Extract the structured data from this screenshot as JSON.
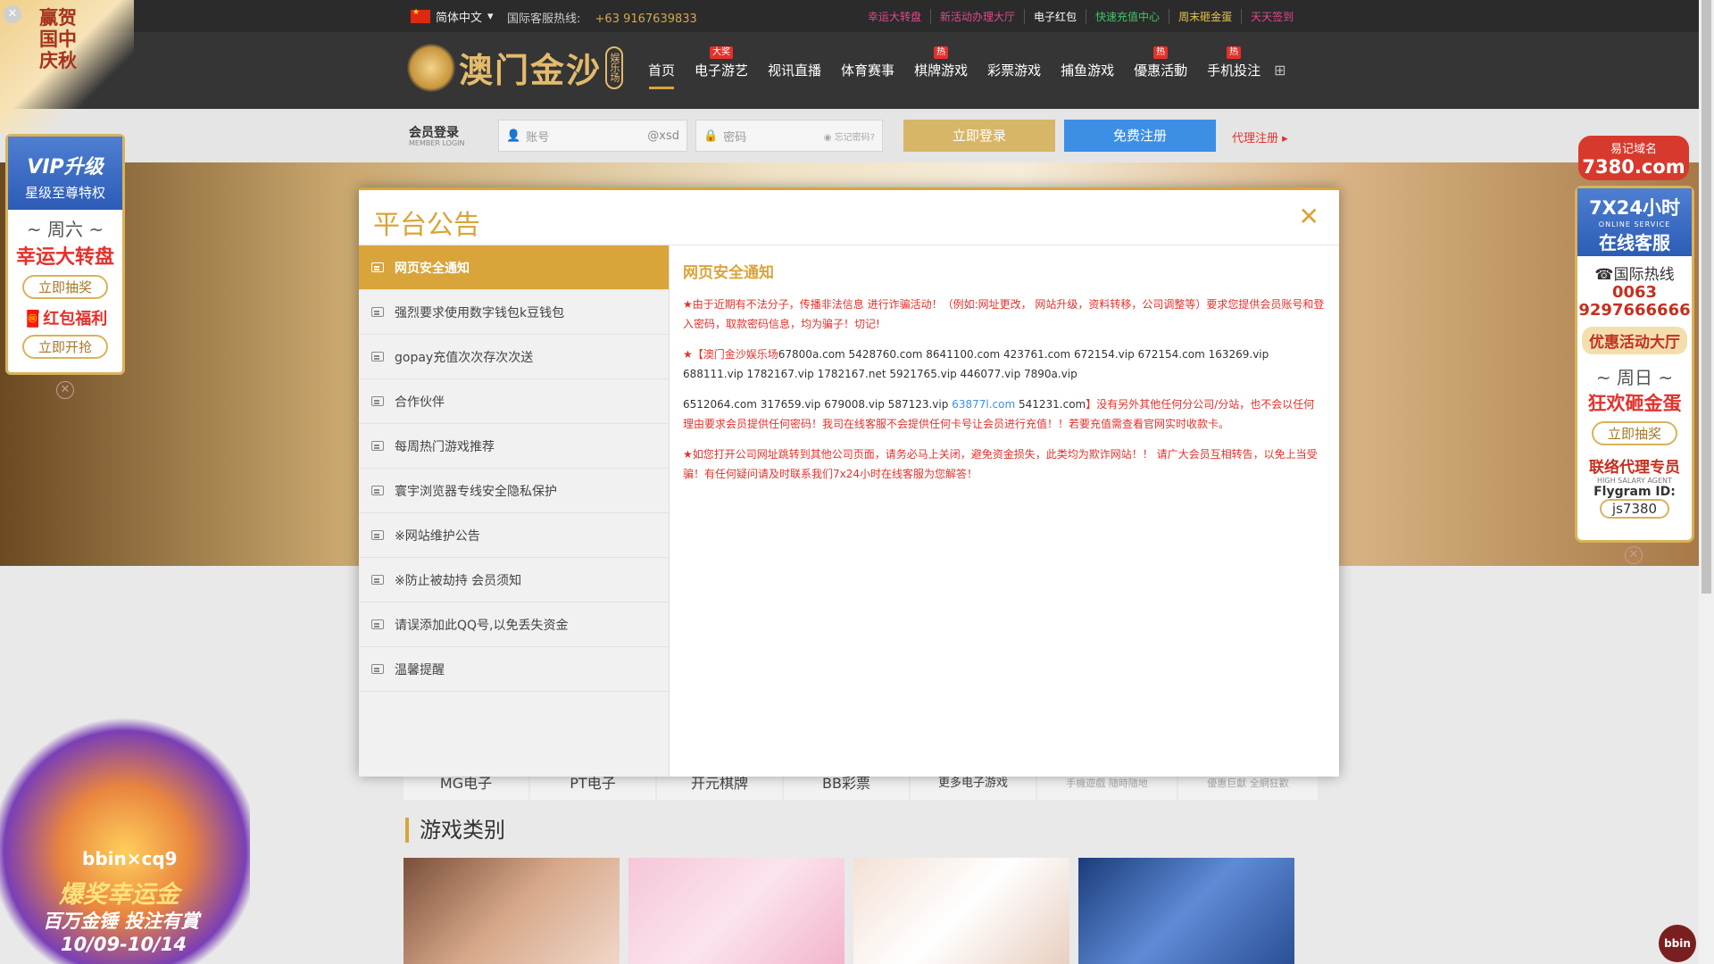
{
  "topbar": {
    "language": "简体中文",
    "hotline_label": "国际客服热线:",
    "hotline_number": "+63 9167639833",
    "links": [
      "幸运大转盘",
      "新活动办理大厅",
      "电子红包",
      "快速充值中心",
      "周末砸金蛋",
      "天天签到"
    ],
    "link_colors": [
      "#e0488e",
      "#e0488e",
      "#ffffff",
      "#44c26a",
      "#e7c44a",
      "#e0488e"
    ]
  },
  "header": {
    "logo_text": "澳门金沙",
    "logo_badge": "娱乐场",
    "nav": [
      {
        "label": "首页",
        "tag": ""
      },
      {
        "label": "电子游艺",
        "tag": "大奖"
      },
      {
        "label": "视讯直播",
        "tag": ""
      },
      {
        "label": "体育赛事",
        "tag": ""
      },
      {
        "label": "棋牌游戏",
        "tag": "热"
      },
      {
        "label": "彩票游戏",
        "tag": ""
      },
      {
        "label": "捕鱼游戏",
        "tag": ""
      },
      {
        "label": "優惠活動",
        "tag": "热"
      },
      {
        "label": "手机投注",
        "tag": "热"
      }
    ]
  },
  "login": {
    "title": "会员登录",
    "subtitle": "MEMBER LOGIN",
    "account_placeholder": "账号",
    "account_suffix": "@xsd",
    "password_placeholder": "密码",
    "forgot": "忘记密码?",
    "login_button": "立即登录",
    "register_button": "免费注册",
    "agent_register": "代理注册"
  },
  "modal": {
    "title": "平台公告",
    "items": [
      "网页安全通知",
      "强烈要求使用数字钱包k豆钱包",
      "gopay充值次次存次次送",
      "合作伙伴",
      "每周热门游戏推荐",
      "寰宇浏览器专线安全隐私保护",
      "※网站维护公告",
      "※防止被劫持 会员须知",
      "请误添加此QQ号,以免丢失资金",
      "温馨提醒"
    ],
    "active_index": 0,
    "body_title": "网页安全通知",
    "p1": "★由于近期有不法分子，传播非法信息 进行诈骗活动！（例如:网址更改， 网站升级，资料转移，公司调整等）要求您提供会员账号和登入密码，取款密码信息，均为骗子！切记!",
    "p2_prefix": "★【澳门金沙娱乐场",
    "p2_domains": "67800a.com  5428760.com  8641100.com  423761.com   672154.vip   672154.com    163269.vip   688111.vip   1782167.vip  1782167.net   5921765.vip  446077.vip  7890a.vip",
    "p3_domains": "6512064.com    317659.vip   679008.vip     587123.vip",
    "p3_link": "63877l.com",
    "p3_more": "541231.com",
    "p3_text": "】没有另外其他任何分公司/分站，也不会以任何理由要求会员提供任何密码！我司在线客服不会提供任何卡号让会员进行充值！！若要充值需查看官网实时收款卡。",
    "p4": "★如您打开公司网址跳转到其他公司页面，请务必马上关闭，避免资金损失，此类均为欺诈网站！！ 请广大会员互相转告，以免上当受骗！有任何疑问请及时联系我们7x24小时在线客服为您解答！"
  },
  "left_float": {
    "vip_title": "VIP升级",
    "vip_sub": "星级至尊特权",
    "day": "~ 周六 ~",
    "wheel": "幸运大转盘",
    "draw_button": "立即抽奖",
    "redpack": "红包福利",
    "grab_button": "立即开抢"
  },
  "corner_banner": {
    "text": "赢贺国中庆秋"
  },
  "promo": {
    "brand": "bbin×cq9",
    "t1": "爆奖幸运金",
    "t2": "百万金锤 投注有賞",
    "t3": "10/09-10/14"
  },
  "right_float": {
    "domain_label": "易记域名",
    "domain": "7380.com",
    "svc_big": "7X24小时",
    "svc_mini": "ONLINE SERVICE",
    "svc_mid": "在线客服",
    "hotline_label": "国际热线",
    "hotline_1": "0063",
    "hotline_2": "9297666666",
    "hall": "优惠活动大厅",
    "day": "~ 周日 ~",
    "egg": "狂欢砸金蛋",
    "draw_button": "立即抽奖",
    "agent": "联络代理专员",
    "high_salary": "HIGH SALARY AGENT",
    "flygram": "Flygram ID:",
    "flygram_id": "js7380"
  },
  "game_tabs": [
    "MG电子",
    "PT电子",
    "开元棋牌",
    "BB彩票",
    "更多电子游戏"
  ],
  "game_tabs_faint": [
    "手機遊戲 隨時隨地",
    "優惠巨獻 全網狂歡"
  ],
  "section_title": "游戏类别",
  "bbin_badge": "bbin",
  "colors": {
    "accent": "#d9a43a",
    "danger": "#e4312b",
    "blue": "#3d8fe6"
  }
}
